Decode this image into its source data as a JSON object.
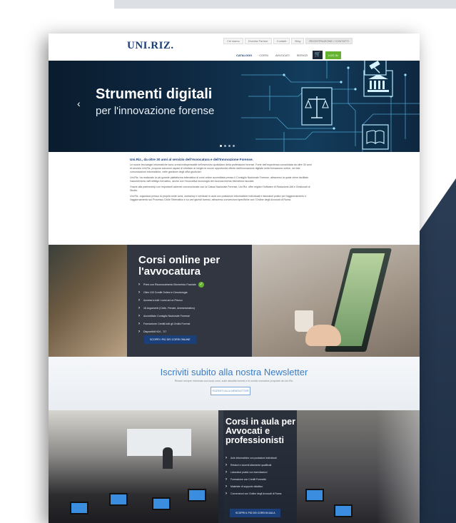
{
  "header": {
    "logo": "UNI.RIZ.",
    "logo_sub": "",
    "top_links": [
      "Chi siamo",
      "Diventa Partner",
      "Contatti",
      "Blog"
    ],
    "account_label": "REGISTRAZIONE / CONTATTI",
    "nav": [
      {
        "label": "CATALOGO",
        "active": true
      },
      {
        "label": "CORSI",
        "active": false
      },
      {
        "label": "AVVOCATI",
        "active": false
      },
      {
        "label": "SERVIZI",
        "active": false
      }
    ],
    "cart_icon": "cart-icon",
    "login_label": "LOG IN"
  },
  "hero": {
    "title": "Strumenti digitali",
    "subtitle": "per l'innovazione forense",
    "prev_icon": "chevron-left-icon"
  },
  "intro": {
    "lead": "Uni.Riz., da oltre 30 anni al servizio dell'Avvocatura e dell'Innovazione Forense.",
    "p1": "Le nuove tecnologie informatiche sono ormai indispensabili nell'esercizio quotidiano della professione forense. Forte dell'esperienza consolidata da oltre 30 anni di servizio Uni.Riz. propone soluzioni capaci di sfruttare al meglio le nuove opportunità offerte dall'innovazione digitale nella formazione online, nei tele comunicazioni informatiche, nelle gestione degli uffici giudiziari.",
    "p2": "Uni.Riz. ha realizzato la più grande piattaforma telematica di corsi online accreditata presso il Consiglio Nazionale Forense, attraverso la quale viene facilitato l'assolvimento dell'obbligo formativo, anche con l'innovativa tecnologia del riconoscimento biometrico facciale.",
    "p3": "Grazie alla partnership con importanti aziende convenzionate con la Cassa Nazionale Forense, Uni.Riz. offre migliori Software di Redazione Atti e Gestionali di Studio.",
    "p4": "Uni.Riz. organizza presso la propria sede corsi, workshop e seminari in aula con postazioni informatiche individuali e laboratori pratici per l'aggiornamento e l'aggiornamento sul Processo Civile Telematico e su vari giuristi forensi, attraverso convenzioni specifiche con l'Ordine degli Avvocati di Roma."
  },
  "online": {
    "title_line1": "Corsi online per",
    "title_line2": "l'avvocatura",
    "items": [
      "Primi con Riconoscimento Biometrico Facciale",
      "Oltre 100 Crediti Online in Deontologia",
      "Accessi a tutti i corsi ad un Prezzo",
      "16 Argomenti (Civile, Penale, Amministrativo)",
      "Accreditato Consiglio Nazionale Forense",
      "Formazione Crediti tutti gli Ordini Forensi",
      "Disponibili H24 - 7/7"
    ],
    "check_icon": "check-circle-icon",
    "button": "SCOPRI I PIÙ DEI CORSI ONLINE"
  },
  "newsletter": {
    "title": "Iscriviti subito alla nostra Newsletter",
    "text": "Rimani sempre informato sui nuovi corsi, sulle attualità forensi e le novità normative proposte da Uni.Riz.",
    "button": "ISCRIVITI ALLA NEWSLETTER"
  },
  "aula": {
    "title_line1": "Corsi in aula per",
    "title_line2": "Avvocati e",
    "title_line3": "professionisti",
    "items": [
      "Aule informatiche con postazioni individuali",
      "Relatori e docenti altamente qualificati",
      "Laboratori pratici con esercitazioni",
      "Formazione con Crediti Formativi",
      "Materiale di supporto didattico",
      "Convenzioni con Ordine degli Avvocati di Roma"
    ],
    "button": "SCOPRI IL PIÙ DEI CORSI IN AULA"
  }
}
